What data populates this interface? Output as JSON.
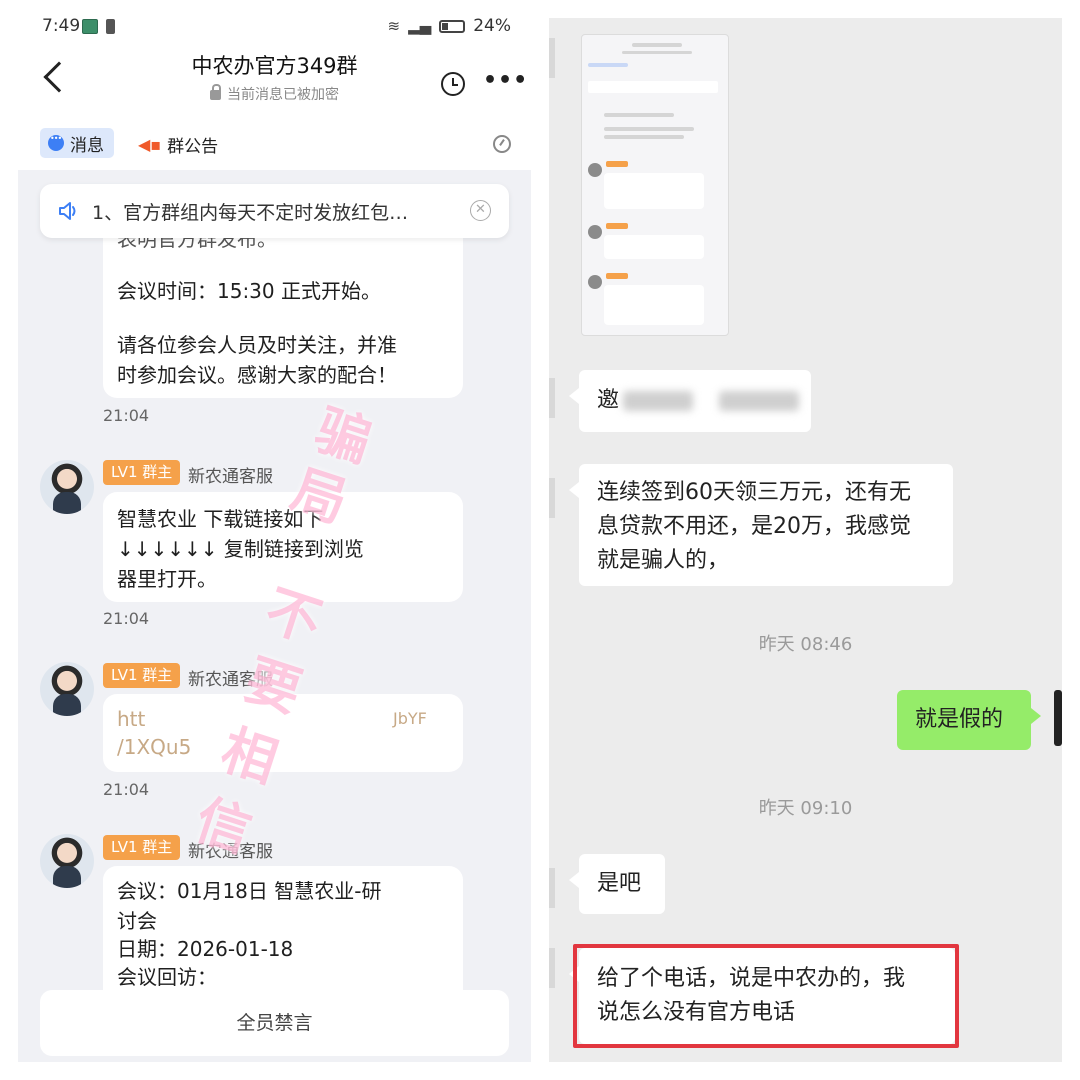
{
  "left": {
    "status": {
      "time": "7:49",
      "battery": "24%"
    },
    "header": {
      "title": "中农办官方349群",
      "subtitle": "当前消息已被加密"
    },
    "tabs": {
      "messages": "消息",
      "announcement": "群公告"
    },
    "notice": "1、官方群组内每天不定时发放红包…",
    "messages": [
      {
        "lines": [
          "表明官方群发布。",
          "会议时间：15:30 正式开始。",
          "请各位参会人员及时关注，并准",
          "时参加会议。感谢大家的配合！"
        ],
        "time": "21:04"
      },
      {
        "badge": "LV1 群主",
        "sender": "新农通客服",
        "lines": [
          "智慧农业 下载链接如下",
          "↓↓↓↓↓↓  复制链接到浏览",
          "器里打开。"
        ],
        "time": "21:04"
      },
      {
        "badge": "LV1 群主",
        "sender": "新农通客服",
        "lines": [
          "htt",
          "/1XQu5",
          "JbYF"
        ],
        "time": "21:04"
      },
      {
        "badge": "LV1 群主",
        "sender": "新农通客服",
        "lines": [
          "会议：01月18日  智慧农业-研",
          "讨会",
          "日期：2026-01-18",
          "会议回访："
        ]
      }
    ],
    "mute_all": "全员禁言",
    "watermark": [
      "骗",
      "局",
      "不",
      "要",
      "相",
      "信"
    ]
  },
  "right": {
    "messages": [
      {
        "from": "other",
        "text": "邀"
      },
      {
        "from": "other",
        "lines": [
          "连续签到60天领三万元，还有无",
          "息贷款不用还，是20万，我感觉",
          "就是骗人的，"
        ]
      },
      {
        "type": "time",
        "text": "昨天 08:46"
      },
      {
        "from": "me",
        "text": "就是假的"
      },
      {
        "type": "time",
        "text": "昨天 09:10"
      },
      {
        "from": "other",
        "text": "是吧"
      },
      {
        "from": "other",
        "lines": [
          "给了个电话，说是中农办的，我",
          "说怎么没有官方电话"
        ],
        "highlighted": true
      }
    ]
  },
  "colors": {
    "accent_blue": "#3d7ff5",
    "badge_orange": "#f5a14a",
    "wechat_green": "#95ec69",
    "highlight_red": "#e2363f"
  }
}
